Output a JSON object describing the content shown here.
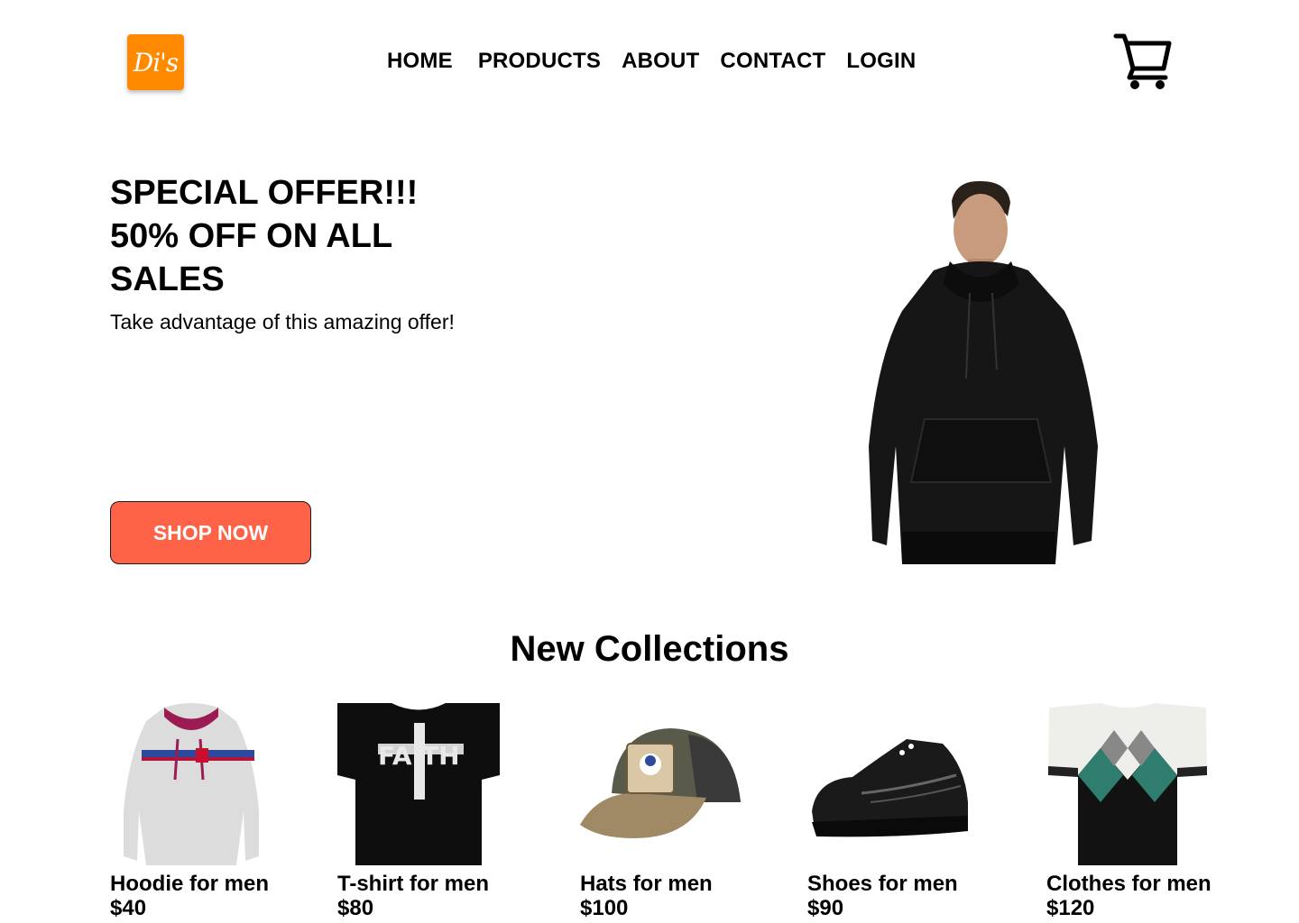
{
  "header": {
    "logo_text": "Di's",
    "nav": [
      {
        "label": "HOME"
      },
      {
        "label": "PRODUCTS"
      },
      {
        "label": "ABOUT"
      },
      {
        "label": "CONTACT"
      },
      {
        "label": "LOGIN"
      }
    ],
    "cart_icon": "shopping-cart-icon"
  },
  "hero": {
    "title_lines": [
      "SPECIAL OFFER!!!",
      "50% OFF ON ALL",
      "SALES"
    ],
    "subtitle": "Take advantage of this amazing offer!",
    "cta_label": "SHOP NOW",
    "cta_color": "#ff6347"
  },
  "collections": {
    "title": "New Collections",
    "products": [
      {
        "name": "Hoodie for men",
        "price": "$40"
      },
      {
        "name": "T-shirt for men",
        "price": "$80"
      },
      {
        "name": "Hats for men",
        "price": "$100"
      },
      {
        "name": "Shoes for men",
        "price": "$90"
      },
      {
        "name": "Clothes for men",
        "price": "$120"
      }
    ]
  },
  "colors": {
    "logo_bg": "#ff8a00",
    "cta": "#ff6347"
  }
}
